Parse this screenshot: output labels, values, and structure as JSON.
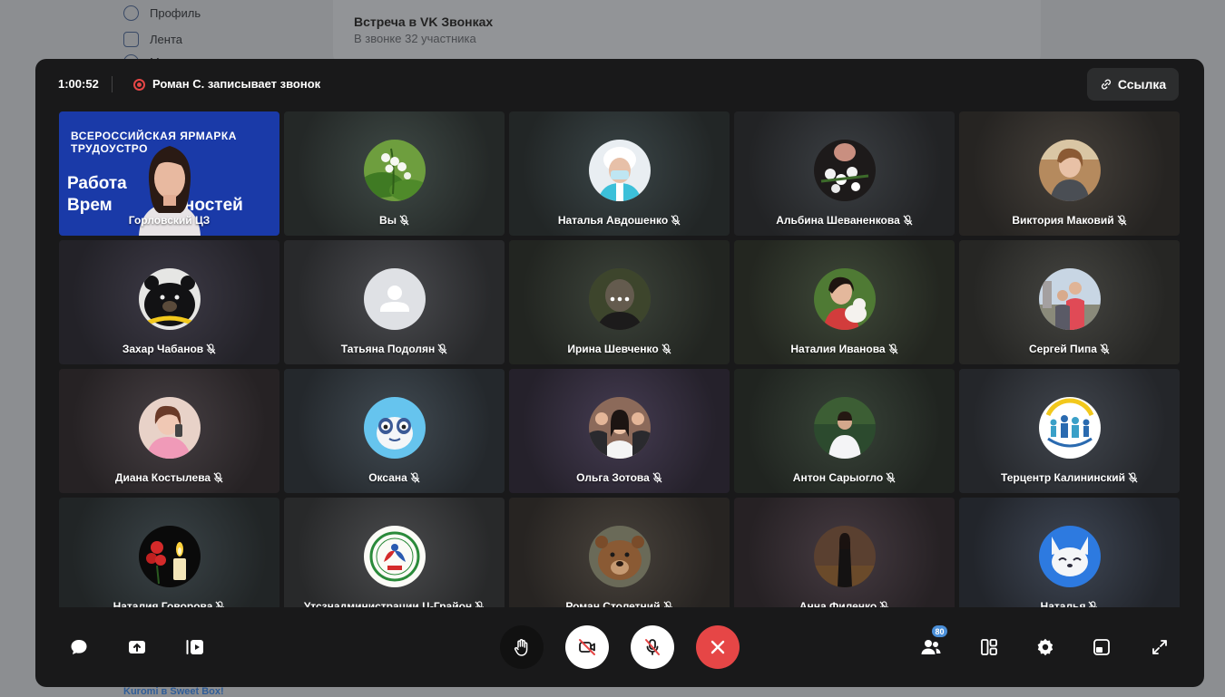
{
  "background_page": {
    "nav": [
      {
        "label": "Профиль"
      },
      {
        "label": "Лента"
      },
      {
        "label": "Ме"
      }
    ],
    "card_title": "Встреча в VK Звонках",
    "card_subtitle": "В звонке 32 участника",
    "bottom_link": "Kuromi в Sweet Box!"
  },
  "call": {
    "timer": "1:00:52",
    "recording_text": "Роман С. записывает звонок",
    "link_button_label": "Ссылка",
    "video_tile": {
      "banner_line1": "ВСЕРОССИЙСКАЯ ЯРМАРКА",
      "banner_line2": "ТРУДОУСТРО",
      "banner_big1": "Работа      ии.",
      "banner_big2": "Врем               ностей",
      "name": "Горловский ЦЗ"
    },
    "participants": [
      {
        "name": "Вы",
        "muted": true,
        "avatar": "lily-of-valley"
      },
      {
        "name": "Наталья Авдошенко",
        "muted": true,
        "avatar": "nurse"
      },
      {
        "name": "Альбина Шеваненкова",
        "muted": true,
        "avatar": "flowers"
      },
      {
        "name": "Виктория Маковий",
        "muted": true,
        "avatar": "woman"
      },
      {
        "name": "Захар Чабанов",
        "muted": true,
        "avatar": "bear-black"
      },
      {
        "name": "Татьяна Подолян",
        "muted": true,
        "avatar": "placeholder-user"
      },
      {
        "name": "Ирина Шевченко",
        "muted": true,
        "avatar": "woman-loading"
      },
      {
        "name": "Наталия Иванова",
        "muted": true,
        "avatar": "woman-cat"
      },
      {
        "name": "Сергей Пипа",
        "muted": true,
        "avatar": "couple"
      },
      {
        "name": "Диана Костылева",
        "muted": true,
        "avatar": "girl-pink"
      },
      {
        "name": "Оксана",
        "muted": true,
        "avatar": "cartoon-lemur"
      },
      {
        "name": "Ольга Зотова",
        "muted": true,
        "avatar": "group"
      },
      {
        "name": "Антон Сарыогло",
        "muted": true,
        "avatar": "man-forest"
      },
      {
        "name": "Терцентр Калининский",
        "muted": true,
        "avatar": "family-logo"
      },
      {
        "name": "Наталия Говорова",
        "muted": true,
        "avatar": "candle-carnations"
      },
      {
        "name": "Утсзнадминистрации Ц-Грайон",
        "muted": true,
        "avatar": "emblem"
      },
      {
        "name": "Роман Столетний",
        "muted": true,
        "avatar": "brown-bear"
      },
      {
        "name": "Анна Филенко",
        "muted": true,
        "avatar": "woman-dark"
      },
      {
        "name": "Наталья",
        "muted": true,
        "avatar": "cartoon-corgi"
      }
    ],
    "participants_count_badge": "80"
  }
}
